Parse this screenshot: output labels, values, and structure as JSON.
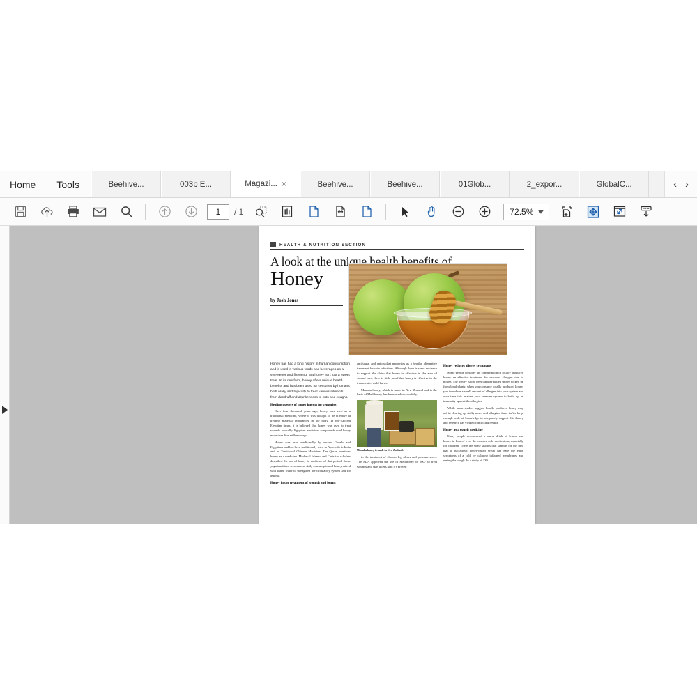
{
  "window": {
    "tabbar": {
      "menu_tabs": [
        {
          "label": "Home",
          "name": "home"
        },
        {
          "label": "Tools",
          "name": "tools"
        }
      ],
      "doc_tabs": [
        {
          "label": "Beehive...",
          "active": false,
          "closable": false
        },
        {
          "label": "003b E...",
          "active": false,
          "closable": false
        },
        {
          "label": "Magazi...",
          "active": true,
          "closable": true,
          "close_glyph": "×"
        },
        {
          "label": "Beehive...",
          "active": false,
          "closable": false
        },
        {
          "label": "Beehive...",
          "active": false,
          "closable": false
        },
        {
          "label": "01Glob...",
          "active": false,
          "closable": false
        },
        {
          "label": "2_expor...",
          "active": false,
          "closable": false
        },
        {
          "label": "GlobalC...",
          "active": false,
          "closable": false
        }
      ],
      "nav_prev": "‹",
      "nav_next": "›"
    },
    "toolbar": {
      "icons_left": [
        {
          "name": "save-icon",
          "title": "Save"
        },
        {
          "name": "upload-cloud-icon",
          "title": "Upload to cloud"
        },
        {
          "name": "print-icon",
          "title": "Print"
        },
        {
          "name": "email-icon",
          "title": "Email"
        },
        {
          "name": "search-icon",
          "title": "Find"
        }
      ],
      "page_up_icon": "up-circle-arrow-icon",
      "page_down_icon": "down-circle-arrow-icon",
      "page_number": "1",
      "page_total": "/ 1",
      "icons_mid": [
        {
          "name": "marquee-zoom-icon",
          "title": "Marquee zoom"
        },
        {
          "name": "page-thumbnails-icon",
          "title": "Page thumbnails"
        },
        {
          "name": "fit-page-icon",
          "title": "Fit page"
        },
        {
          "name": "fit-width-icon",
          "title": "Fit width"
        },
        {
          "name": "actual-size-icon",
          "title": "Actual size"
        }
      ],
      "select_tool_icon": "cursor-arrow-icon",
      "hand_tool_icon": "hand-icon",
      "zoom_out_icon": "zoom-out-icon",
      "zoom_in_icon": "zoom-in-icon",
      "zoom_value": "72.5%",
      "icons_right": [
        {
          "name": "fit-visible-icon",
          "title": "Fit visible"
        },
        {
          "name": "fit-page-blue-icon",
          "title": "Fit one full page"
        },
        {
          "name": "fullscreen-icon",
          "title": "Full screen mode"
        },
        {
          "name": "show-toolbar-icon",
          "title": "Show toolbar"
        }
      ],
      "accent_color": "#1c5fab"
    },
    "viewer": {
      "sidebar_expand_icon": "expand-panel-arrow-icon",
      "background_color": "#bfbfbf"
    }
  },
  "document": {
    "section_label": "HEALTH & NUTRITION SECTION",
    "headline_line1": "A look at the unique health benefits of",
    "headline_line2": "Honey",
    "byline": "by Josh Jones",
    "hero_image_alt": "Two green apples beside a glass bowl of honey with a wooden dipper",
    "bee_image_alt": "Beekeeper in white suit inspecting a honeycomb frame",
    "bee_caption": "Manuka honey is made in New Zealand.",
    "column1": {
      "intro": "Honey has had a long history in human consumption and is used in various foods and beverages as a sweetener and flavoring. But honey isn't just a sweet treat. In its raw form, honey offers unique health benefits and has been used for centuries by humans both orally and topically to treat various ailments from dandruff and drunkenness to cuts and coughs.",
      "heading1": "Healing powers of honey known for centuries",
      "para1": "Over four thousand years ago, honey was used as a traditional medicine, where it was thought to be effective at treating material imbalances in the body. In pre-Ancient Egyptian times, it is believed that honey was used to treat wounds topically. Egyptian medicinal compounds used honey more than five millennia ago.",
      "para2": "Honey was used medicinally by ancient Greeks and Egyptians and has been traditionally used in Ayurveda in India and in Traditional Chinese Medicine. The Quran mentions honey as a medicine. Medieval Islamic and Christian scholars described the use of honey in medicine of that period. Some yoga traditions recommend daily consumption of honey mixed with warm water to strengthen the circulatory system and for asthma.",
      "heading2": "Honey in the treatment of wounds and burns"
    },
    "column2": {
      "para1": "antifungal and antioxidant properties as a healthy alternative treatment for skin infections. Although there is some evidence to support the claim that honey is effective in the area of wound care, there is little proof that honey is effective in the treatment of mild burns.",
      "para2": "Manuka honey, which is made in New Zealand and is the basis of Medihoney, has been used successfully",
      "para3": "in the treatment of chronic leg ulcers and pressure sores. The FDA approved the use of Medihoney in 2007 to treat wounds and skin ulcers, and it's proven"
    },
    "column3": {
      "heading1": "Honey reduces allergy symptoms",
      "para1": "Some people consider the consumption of locally produced honey an effective treatment for seasonal allergies due to pollen. The theory is that bees transfer pollen spores picked up from local plants; when you consume locally produced honey, you introduce a small amount of allergen into your system and over time this enables your immune system to build up an immunity against the allergies.",
      "para2": "While some studies suggest locally produced honey may aid in clearing up stuffy noses and allergies, there isn't a large enough body of knowledge to adequately support this theory and research has yielded conflicting results.",
      "heading2": "Honey as a cough medicine",
      "para3": "Many people recommend a warm drink of lemon and honey in lieu of over the counter cold medication, especially for children. There are some studies that support for the idea that a buckwheat honey-based syrup can ease the early symptoms of a cold by calming inflamed membranes and easing the cough. In a study of 139"
    }
  }
}
